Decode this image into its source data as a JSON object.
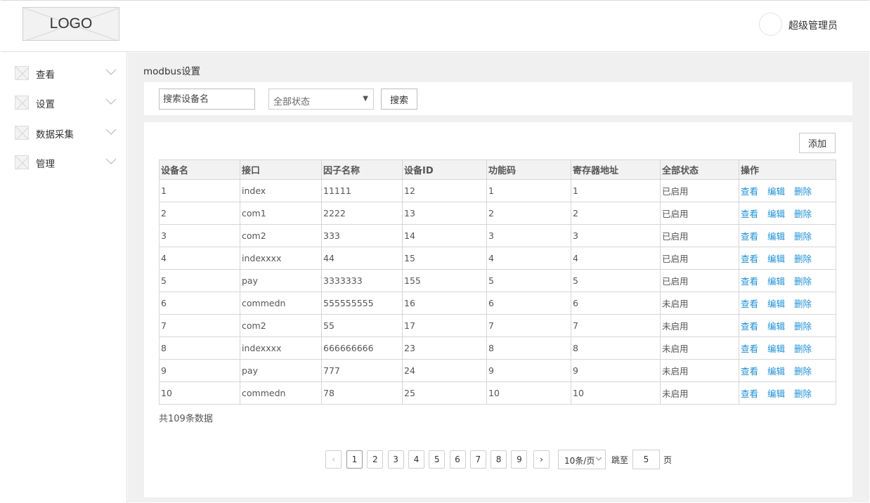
{
  "header": {
    "logo_text": "LOGO",
    "username": "超级管理员"
  },
  "sidebar": {
    "items": [
      {
        "label": "查看"
      },
      {
        "label": "设置"
      },
      {
        "label": "数据采集"
      },
      {
        "label": "管理"
      }
    ]
  },
  "main": {
    "page_title": "modbus设置",
    "search": {
      "placeholder": "搜索设备名",
      "status_selected": "全部状态",
      "search_label": "搜索"
    },
    "add_label": "添加",
    "table": {
      "columns": [
        "设备名",
        "接口",
        "因子名称",
        "设备ID",
        "功能码",
        "寄存器地址",
        "全部状态",
        "操作"
      ],
      "rows": [
        {
          "name": "1",
          "interface": "index",
          "factor": "11111",
          "device_id": "12",
          "func_code": "1",
          "register": "1",
          "status": "已启用"
        },
        {
          "name": "2",
          "interface": "com1",
          "factor": "2222",
          "device_id": "13",
          "func_code": "2",
          "register": "2",
          "status": "已启用"
        },
        {
          "name": "3",
          "interface": "com2",
          "factor": "333",
          "device_id": "14",
          "func_code": "3",
          "register": "3",
          "status": "已启用"
        },
        {
          "name": "4",
          "interface": "indexxxx",
          "factor": "44",
          "device_id": "15",
          "func_code": "4",
          "register": "4",
          "status": "已启用"
        },
        {
          "name": "5",
          "interface": "pay",
          "factor": "3333333",
          "device_id": "155",
          "func_code": "5",
          "register": "5",
          "status": "已启用"
        },
        {
          "name": "6",
          "interface": "commedn",
          "factor": "555555555",
          "device_id": "16",
          "func_code": "6",
          "register": "6",
          "status": "未启用"
        },
        {
          "name": "7",
          "interface": "com2",
          "factor": "55",
          "device_id": "17",
          "func_code": "7",
          "register": "7",
          "status": "未启用"
        },
        {
          "name": "8",
          "interface": "indexxxx",
          "factor": "666666666",
          "device_id": "23",
          "func_code": "8",
          "register": "8",
          "status": "未启用"
        },
        {
          "name": "9",
          "interface": "pay",
          "factor": "777",
          "device_id": "24",
          "func_code": "9",
          "register": "9",
          "status": "未启用"
        },
        {
          "name": "10",
          "interface": "commedn",
          "factor": "78",
          "device_id": "25",
          "func_code": "10",
          "register": "10",
          "status": "未启用"
        }
      ],
      "actions": {
        "view": "查看",
        "edit": "编辑",
        "delete": "删除"
      },
      "link_color": "#1e90d6"
    },
    "total_text": "共109条数据",
    "pagination": {
      "prev": "‹",
      "next": "›",
      "pages": [
        "1",
        "2",
        "3",
        "4",
        "5",
        "6",
        "7",
        "8",
        "9"
      ],
      "current": "1",
      "page_size": "10条/页",
      "jump_label": "跳至",
      "jump_value": "5",
      "jump_unit": "页"
    }
  }
}
